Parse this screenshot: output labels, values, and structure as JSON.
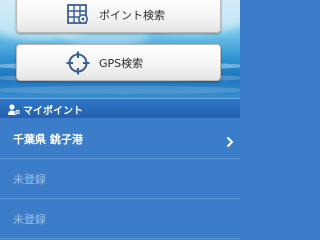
{
  "colors": {
    "header_bg": "#2e77c9",
    "list_bg": "#3b7dc9",
    "active_text": "#ffffff",
    "empty_text": "#9cc0e8"
  },
  "buttons": {
    "point_search": {
      "label": "ポイント検索",
      "icon": "map-pin-grid-icon"
    },
    "gps_search": {
      "label": "GPS検索",
      "icon": "crosshair-target-icon"
    }
  },
  "my_points": {
    "header_label": "マイポイント",
    "header_icon": "user-pin-icon",
    "items": [
      {
        "label": "千葉県 銚子港",
        "registered": true,
        "icon": "chevron-right-icon"
      },
      {
        "label": "未登録",
        "registered": false
      },
      {
        "label": "未登録",
        "registered": false
      }
    ]
  }
}
